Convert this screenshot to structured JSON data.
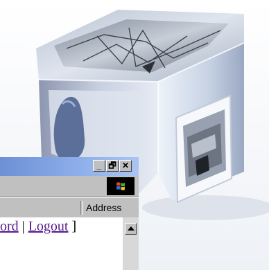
{
  "window": {
    "controls": {
      "minimize": "_",
      "restore": "🗗",
      "close": "✕"
    },
    "address_label": "Address"
  },
  "content": {
    "link_partial": "ord",
    "separator": "|",
    "logout": "Logout",
    "bracket": "]"
  },
  "colors": {
    "titlebar": "#7a9ce0",
    "chrome": "#c0c0c0",
    "visited_link": "#551a8b"
  }
}
